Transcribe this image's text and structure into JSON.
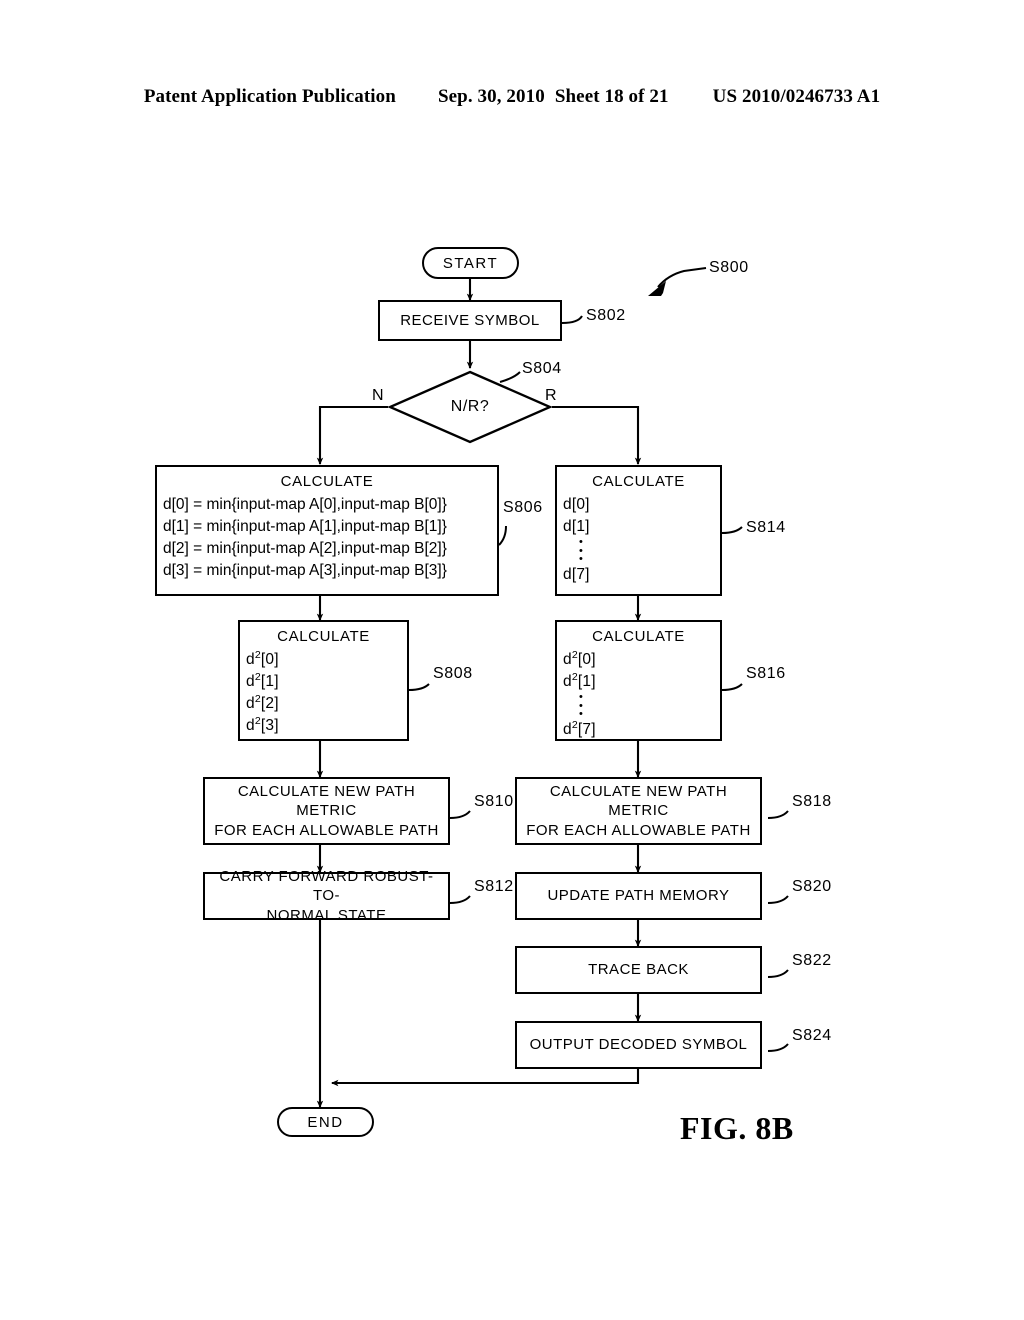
{
  "header": {
    "publication": "Patent Application Publication",
    "date": "Sep. 30, 2010",
    "sheet": "Sheet 18 of 21",
    "patent_number": "US 2010/0246733 A1"
  },
  "figure": {
    "caption": "FIG. 8B",
    "flow_ref": "S800"
  },
  "nodes": {
    "start": {
      "label": "START"
    },
    "end": {
      "label": "END"
    },
    "receive_symbol": {
      "label": "RECEIVE SYMBOL",
      "ref": "S802"
    },
    "decision": {
      "label": "N/R?",
      "ref": "S804",
      "branch_left": "N",
      "branch_right": "R"
    },
    "calc_d_normal": {
      "title": "CALCULATE",
      "ref": "S806",
      "lines": [
        "d[0] = min{input-map A[0],input-map B[0]}",
        "d[1] = min{input-map A[1],input-map B[1]}",
        "d[2] = min{input-map A[2],input-map B[2]}",
        "d[3] = min{input-map A[3],input-map B[3]}"
      ]
    },
    "calc_d_robust": {
      "title": "CALCULATE",
      "ref": "S814",
      "lines": [
        "d[0]",
        "d[1]",
        "⋮",
        "d[7]"
      ]
    },
    "calc_dsq_normal": {
      "title": "CALCULATE",
      "ref": "S808",
      "lines": [
        "d2[0]",
        "d2[1]",
        "d2[2]",
        "d2[3]"
      ]
    },
    "calc_dsq_robust": {
      "title": "CALCULATE",
      "ref": "S816",
      "lines": [
        "d2[0]",
        "d2[1]",
        "⋮",
        "d2[7]"
      ]
    },
    "path_metric_normal": {
      "line1": "CALCULATE NEW PATH METRIC",
      "line2": "FOR EACH ALLOWABLE PATH",
      "ref": "S810"
    },
    "path_metric_robust": {
      "line1": "CALCULATE NEW PATH METRIC",
      "line2": "FOR EACH ALLOWABLE PATH",
      "ref": "S818"
    },
    "carry_forward": {
      "line1": "CARRY FORWARD ROBUST-TO-",
      "line2": "NORMAL STATE",
      "ref": "S812"
    },
    "update_path_memory": {
      "label": "UPDATE PATH MEMORY",
      "ref": "S820"
    },
    "trace_back": {
      "label": "TRACE BACK",
      "ref": "S822"
    },
    "output_decoded": {
      "label": "OUTPUT DECODED SYMBOL",
      "ref": "S824"
    }
  },
  "colors": {
    "ink": "#000000",
    "paper": "#ffffff"
  }
}
